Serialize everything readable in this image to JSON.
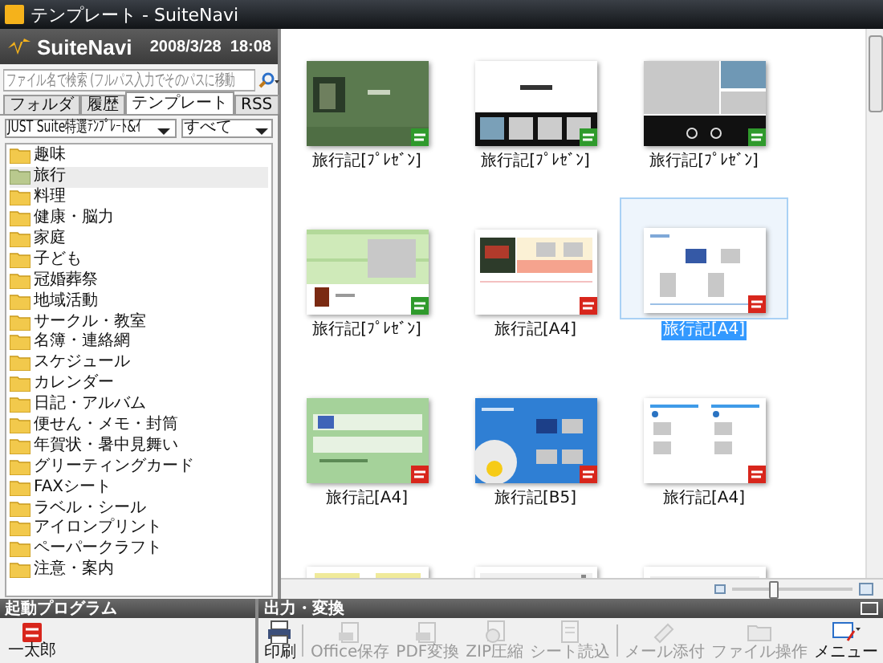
{
  "window": {
    "title": "テンプレート - SuiteNavi"
  },
  "header": {
    "logo": "SuiteNavi",
    "datetime": "2008/3/28  18:08"
  },
  "search": {
    "placeholder": "ファイル名で検索 (フルパス入力でそのパスに移動"
  },
  "tabs": [
    {
      "label": "フォルダ",
      "selected": false
    },
    {
      "label": "履歴",
      "selected": false
    },
    {
      "label": "テンプレート",
      "selected": true
    },
    {
      "label": "RSS",
      "selected": false
    }
  ],
  "filters": [
    {
      "value": "JUST Suite特選ﾃﾝﾌﾟﾚｰﾄ&ｲ"
    },
    {
      "value": "すべて"
    }
  ],
  "tree": [
    {
      "label": "趣味",
      "selected": false
    },
    {
      "label": "旅行",
      "selected": true
    },
    {
      "label": "料理",
      "selected": false
    },
    {
      "label": "健康・脳力",
      "selected": false
    },
    {
      "label": "家庭",
      "selected": false
    },
    {
      "label": "子ども",
      "selected": false
    },
    {
      "label": "冠婚葬祭",
      "selected": false
    },
    {
      "label": "地域活動",
      "selected": false
    },
    {
      "label": "サークル・教室",
      "selected": false
    },
    {
      "label": "名簿・連絡網",
      "selected": false
    },
    {
      "label": "スケジュール",
      "selected": false
    },
    {
      "label": "カレンダー",
      "selected": false
    },
    {
      "label": "日記・アルバム",
      "selected": false
    },
    {
      "label": "便せん・メモ・封筒",
      "selected": false
    },
    {
      "label": "年賀状・暑中見舞い",
      "selected": false
    },
    {
      "label": "グリーティングカード",
      "selected": false
    },
    {
      "label": "FAXシート",
      "selected": false
    },
    {
      "label": "ラベル・シール",
      "selected": false
    },
    {
      "label": "アイロンプリント",
      "selected": false
    },
    {
      "label": "ペーパークラフト",
      "selected": false
    },
    {
      "label": "注意・案内",
      "selected": false
    }
  ],
  "launcher": {
    "title": "起動プログラム",
    "programs": [
      {
        "label": "一太郎"
      }
    ]
  },
  "templates": [
    {
      "label": "旅行記[ﾌﾟﾚｾﾞﾝ]",
      "kind": "presentation",
      "selected": false
    },
    {
      "label": "旅行記[ﾌﾟﾚｾﾞﾝ]",
      "kind": "presentation",
      "selected": false
    },
    {
      "label": "旅行記[ﾌﾟﾚｾﾞﾝ]",
      "kind": "presentation",
      "selected": false
    },
    {
      "label": "旅行記[ﾌﾟﾚｾﾞﾝ]",
      "kind": "presentation",
      "selected": false
    },
    {
      "label": "旅行記[A4]",
      "kind": "document",
      "selected": false
    },
    {
      "label": "旅行記[A4]",
      "kind": "document",
      "selected": true
    },
    {
      "label": "旅行記[A4]",
      "kind": "document",
      "selected": false
    },
    {
      "label": "旅行記[B5]",
      "kind": "document",
      "selected": false
    },
    {
      "label": "旅行記[A4]",
      "kind": "document",
      "selected": false
    },
    {
      "kind": "picture",
      "selected": false
    },
    {
      "kind": "picture",
      "selected": false
    },
    {
      "kind": "picture",
      "selected": false
    }
  ],
  "zoom_slider": {
    "level": 0.35
  },
  "output": {
    "title": "出力・変換",
    "tools": [
      {
        "label": "印刷",
        "kind": "print",
        "disabled": false,
        "separator_after": true
      },
      {
        "label": "Office保存",
        "kind": "office",
        "disabled": true,
        "separator_after": false
      },
      {
        "label": "PDF変換",
        "kind": "pdf",
        "disabled": true,
        "separator_after": false
      },
      {
        "label": "ZIP圧縮",
        "kind": "zip",
        "disabled": true,
        "separator_after": false
      },
      {
        "label": "シート読込",
        "kind": "sheet",
        "disabled": true,
        "separator_after": true
      },
      {
        "label": "メール添付",
        "kind": "mail",
        "disabled": true,
        "separator_after": false
      },
      {
        "label": "ファイル操作",
        "kind": "folder",
        "disabled": true,
        "separator_after": false
      }
    ],
    "menu": {
      "label": "メニュー"
    }
  }
}
